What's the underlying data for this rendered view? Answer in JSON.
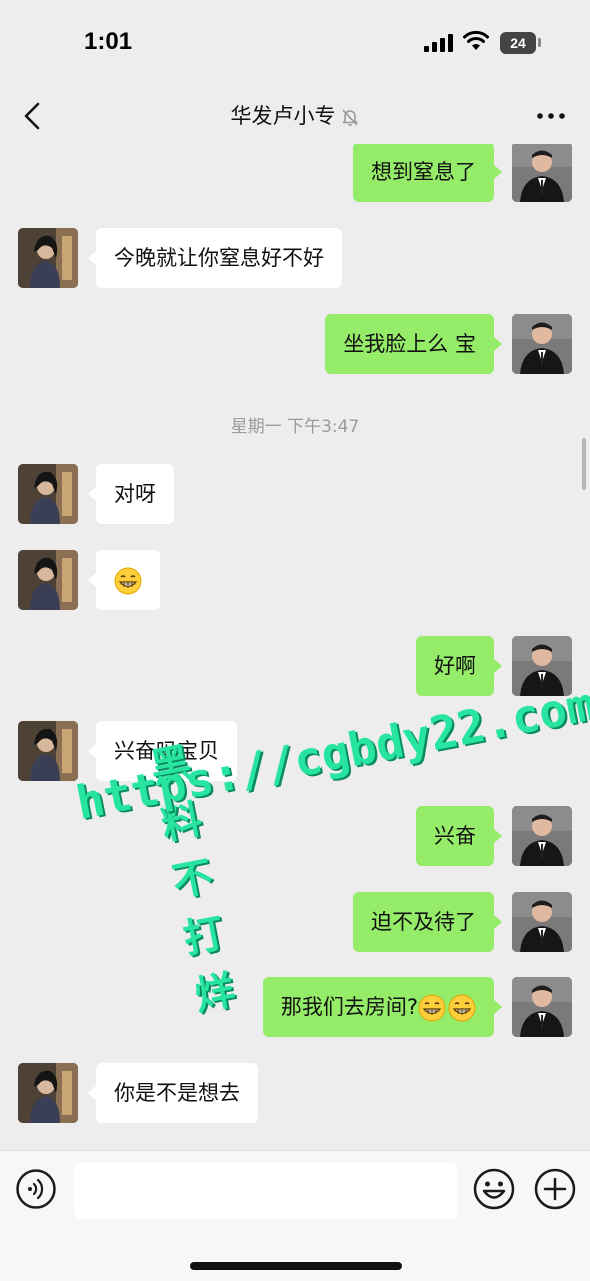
{
  "status_bar": {
    "time": "1:01",
    "battery": "24"
  },
  "header": {
    "title": "华发卢小专"
  },
  "messages": [
    {
      "side": "me",
      "text": "想到窒息了"
    },
    {
      "side": "them",
      "text": "今晚就让你窒息好不好"
    },
    {
      "side": "me",
      "text": "坐我脸上么 宝"
    },
    {
      "type": "time",
      "text": "星期一 下午3:47"
    },
    {
      "side": "them",
      "text": "对呀"
    },
    {
      "side": "them",
      "text": "",
      "emoji": "grin-emoji"
    },
    {
      "side": "me",
      "text": "好啊"
    },
    {
      "side": "them",
      "text": "兴奋吗宝贝"
    },
    {
      "side": "me",
      "text": "兴奋"
    },
    {
      "side": "me",
      "text": "迫不及待了"
    },
    {
      "side": "me",
      "text": "那我们去房间?",
      "emoji": "grin-emoji x2"
    },
    {
      "side": "them",
      "text": "你是不是想去"
    }
  ],
  "watermark": {
    "line1": "黑料不打烊",
    "line2": "https://cgbdy22.com"
  },
  "input": {
    "value": "",
    "placeholder": ""
  },
  "colors": {
    "my_bubble": "#95ec69",
    "their_bubble": "#ffffff",
    "background": "#ededed",
    "watermark": "#27e5a1"
  }
}
